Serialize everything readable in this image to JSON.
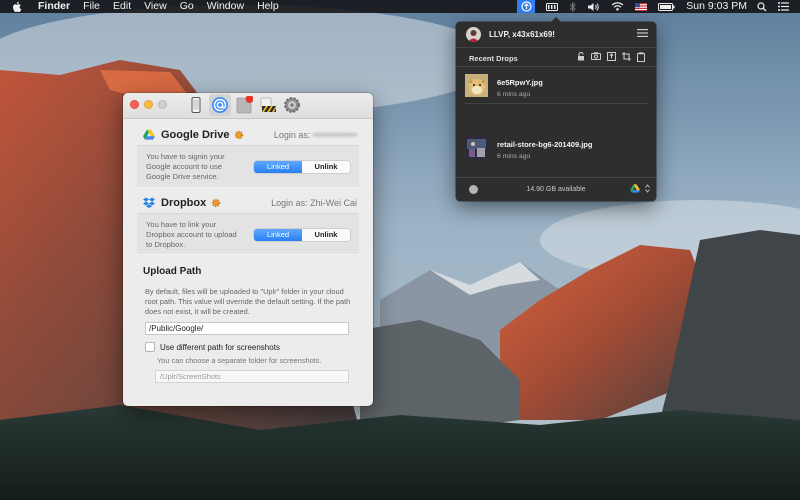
{
  "menubar": {
    "app_name": "Finder",
    "menus": [
      "File",
      "Edit",
      "View",
      "Go",
      "Window",
      "Help"
    ],
    "clock": "Sun 9:03 PM",
    "status_icons": [
      "uplr-icon",
      "memory-icon",
      "bluetooth-icon",
      "volume-icon",
      "wifi-icon",
      "us-flag-icon",
      "battery-icon"
    ]
  },
  "prefs": {
    "toolbar_icons": [
      "iphone-icon",
      "at-sign-icon",
      "notes-icon",
      "caution-icon",
      "gear-icon"
    ],
    "google": {
      "name": "Google Drive",
      "login_label": "Login as:",
      "login_value": "••••••••••••••",
      "description": "You have to signin your Google account to use Google Drive service.",
      "linked_label": "Linked",
      "unlink_label": "Unlink"
    },
    "dropbox": {
      "name": "Dropbox",
      "login_label": "Login as:",
      "login_value": "Zhi-Wei Cai",
      "description": "You have to link your Dropbox account to upload to Dropbox.",
      "linked_label": "Linked",
      "unlink_label": "Unlink"
    },
    "upload": {
      "title": "Upload Path",
      "description": "By default, files will be uploaded to \"Uplr\" folder in your cloud root path. This value will override the default setting. If the path does not exist, it will be created.",
      "path_value": "/Public/Google/",
      "checkbox_label": "Use different path for screenshots",
      "checkbox_checked": false,
      "hint": "You can choose a separate folder for screenshots.",
      "screenshot_placeholder": "/Uplr/ScreenShots"
    }
  },
  "dropdown": {
    "user": "LLVP, x43x61x69!",
    "recent_label": "Recent Drops",
    "tool_icons": [
      "lock-icon",
      "camera-icon",
      "upload-icon",
      "crop-icon",
      "clipboard-icon"
    ],
    "drops": [
      {
        "name": "6e5RpwY.jpg",
        "time": "6 mins ago"
      },
      {
        "name": "retail-store-bg6-201409.jpg",
        "time": "6 mins ago"
      }
    ],
    "storage": "14.90 GB available"
  }
}
